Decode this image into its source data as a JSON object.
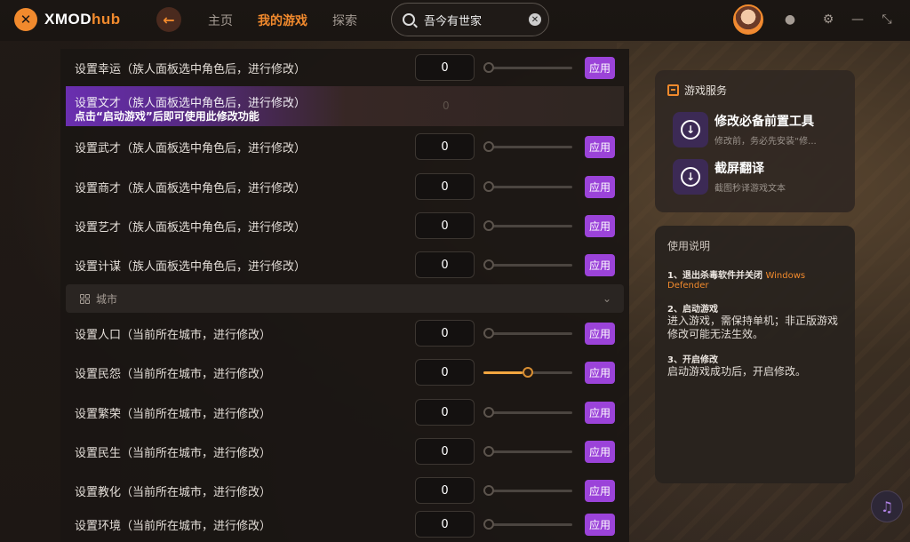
{
  "app": {
    "logo_text": "XMOD",
    "logo_text_hub": "hub"
  },
  "nav": {
    "home": "主页",
    "my_games": "我的游戏",
    "explore": "探索"
  },
  "search": {
    "value": "吾今有世家"
  },
  "rows_top": [
    {
      "label": "设置幸运（族人面板选中角色后，进行修改）",
      "value": "0",
      "apply": "应用",
      "slider": 0
    }
  ],
  "locked_row": {
    "label": "设置文才（族人面板选中角色后，进行修改）",
    "message": "点击“启动游戏”后即可使用此修改功能",
    "value": "0"
  },
  "rows_family": [
    {
      "label": "设置武才（族人面板选中角色后，进行修改）",
      "value": "0",
      "apply": "应用",
      "slider": 0
    },
    {
      "label": "设置商才（族人面板选中角色后，进行修改）",
      "value": "0",
      "apply": "应用",
      "slider": 0
    },
    {
      "label": "设置艺才（族人面板选中角色后，进行修改）",
      "value": "0",
      "apply": "应用",
      "slider": 0
    },
    {
      "label": "设置计谋（族人面板选中角色后，进行修改）",
      "value": "0",
      "apply": "应用",
      "slider": 0
    }
  ],
  "section_city": {
    "title": "城市"
  },
  "rows_city": [
    {
      "label": "设置人口（当前所在城市，进行修改）",
      "value": "0",
      "apply": "应用",
      "slider": 0
    },
    {
      "label": "设置民怨（当前所在城市，进行修改）",
      "value": "0",
      "apply": "应用",
      "slider": 0.5
    },
    {
      "label": "设置繁荣（当前所在城市，进行修改）",
      "value": "0",
      "apply": "应用",
      "slider": 0
    },
    {
      "label": "设置民生（当前所在城市，进行修改）",
      "value": "0",
      "apply": "应用",
      "slider": 0
    },
    {
      "label": "设置教化（当前所在城市，进行修改）",
      "value": "0",
      "apply": "应用",
      "slider": 0
    },
    {
      "label": "设置环境（当前所在城市，进行修改）",
      "value": "0",
      "apply": "应用",
      "slider": 0
    }
  ],
  "services": {
    "title": "游戏服务",
    "tools": [
      {
        "title": "修改必备前置工具",
        "subtitle": "修改前，务必先安装“修..."
      },
      {
        "title": "截屏翻译",
        "subtitle": "截图秒译游戏文本"
      }
    ]
  },
  "manual": {
    "title": "使用说明",
    "step1_head": "1、退出杀毒软件并关闭",
    "step1_link": "Windows Defender",
    "step2_head": "2、启动游戏",
    "step2_body": "进入游戏，需保持单机；非正版游戏修改可能无法生效。",
    "step3_head": "3、开启修改",
    "step3_body": "启动游戏成功后，开启修改。"
  },
  "colors": {
    "accent": "#f18a2d",
    "apply": "#9b43d9"
  }
}
